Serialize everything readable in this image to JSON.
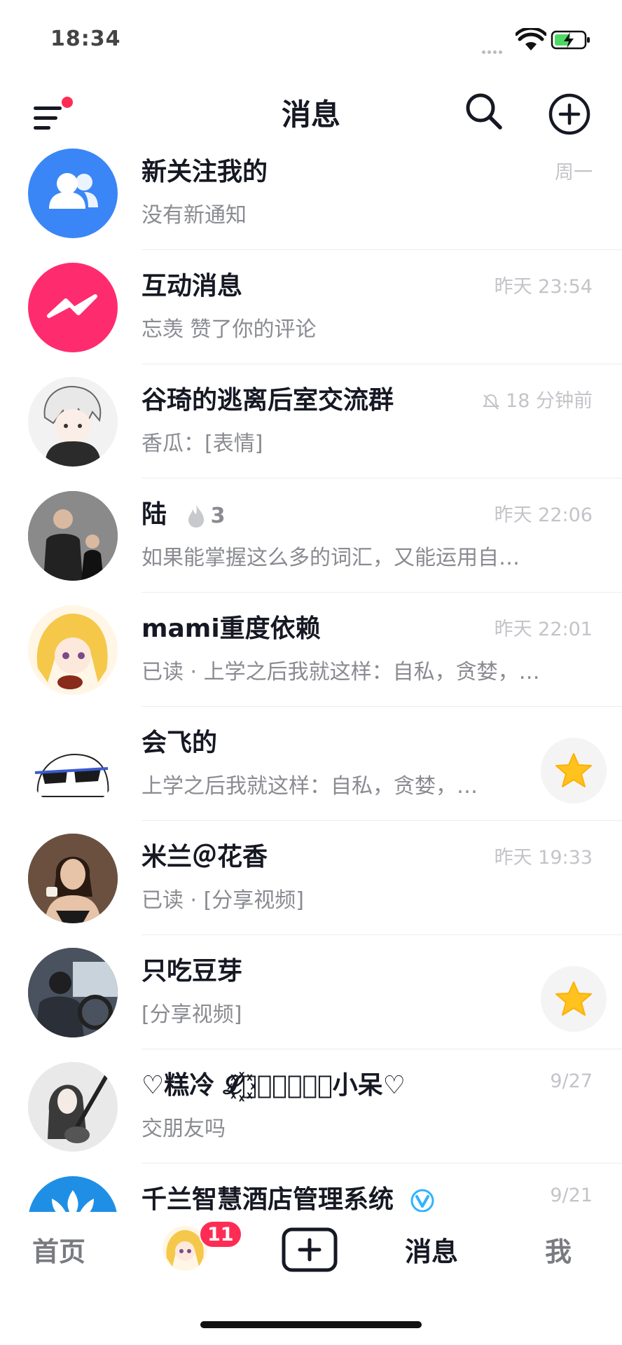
{
  "status_bar": {
    "time": "18:34"
  },
  "nav": {
    "title": "消息"
  },
  "conversations": [
    {
      "name": "新关注我的",
      "preview": "没有新通知",
      "time": "周一"
    },
    {
      "name": "互动消息",
      "preview": "忘羡 赞了你的评论",
      "time": "昨天 23:54"
    },
    {
      "name": "谷琦的逃离后室交流群",
      "preview": "香瓜：[表情]",
      "time": "18 分钟前"
    },
    {
      "name": "陆",
      "fire_count": "3",
      "preview": "如果能掌握这么多的词汇，又能运用自…",
      "time": "昨天 22:06"
    },
    {
      "name": "mami重度依赖",
      "preview": "已读 · 上学之后我就这样：自私，贪婪，…",
      "time": "昨天 22:01"
    },
    {
      "name": "会飞的",
      "preview": "上学之后我就这样：自私，贪婪，…",
      "time": ""
    },
    {
      "name": "米兰＠花香",
      "preview": "已读 · [分享视频]",
      "time": "昨天 19:33"
    },
    {
      "name": "只吃豆芽",
      "preview": "[分享视频]",
      "time": ""
    },
    {
      "name": "♡糕冷 𝓛꙰𝓸꙰𝓿꙰𝓮꙰小呆♡",
      "preview": "交朋友吗",
      "time": "9/27"
    },
    {
      "name": "千兰智慧酒店管理系统",
      "preview": "",
      "time": "9/21"
    }
  ],
  "tab_bar": {
    "home": "首页",
    "friends_badge": "11",
    "messages": "消息",
    "me": "我"
  },
  "colors": {
    "accent": "#fe2c55",
    "follow_blue": "#3a86f7",
    "interact_pink": "#fe2c6e",
    "star": "#ffc21f"
  }
}
